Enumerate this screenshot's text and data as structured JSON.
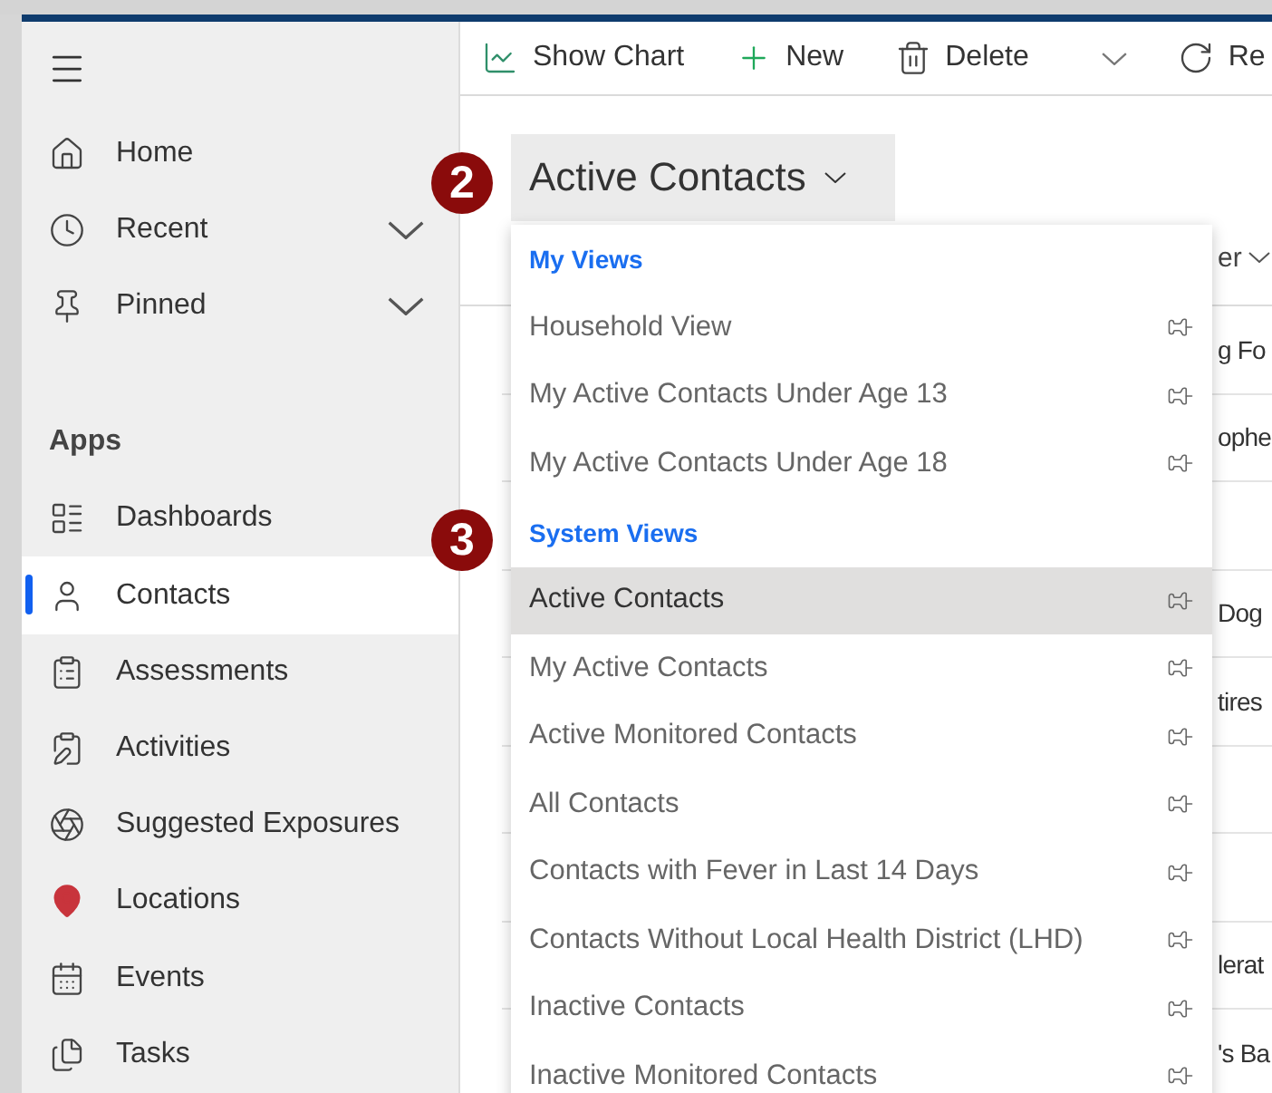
{
  "sidebar": {
    "items": [
      {
        "label": "Home",
        "kind": "link",
        "selected": false
      },
      {
        "label": "Recent",
        "kind": "group",
        "expanded": false,
        "selected": false
      },
      {
        "label": "Pinned",
        "kind": "group",
        "expanded": false,
        "selected": false
      }
    ],
    "section_title": "Apps",
    "apps": [
      {
        "label": "Dashboards",
        "selected": false
      },
      {
        "label": "Contacts",
        "selected": true
      },
      {
        "label": "Assessments",
        "selected": false
      },
      {
        "label": "Activities",
        "selected": false
      },
      {
        "label": "Suggested Exposures",
        "selected": false
      },
      {
        "label": "Locations",
        "selected": false
      },
      {
        "label": "Events",
        "selected": false
      },
      {
        "label": "Tasks",
        "selected": false
      }
    ]
  },
  "command_bar": [
    {
      "kind": "chart",
      "label": "Show Chart"
    },
    {
      "kind": "new",
      "label": "New"
    },
    {
      "kind": "delete",
      "label": "Delete"
    },
    {
      "kind": "split"
    },
    {
      "kind": "refresh",
      "label": "Re"
    }
  ],
  "view_selector": {
    "label": "Active Contacts",
    "expanded": true
  },
  "view_menu": [
    {
      "kind": "header",
      "label": "My Views"
    },
    {
      "kind": "view",
      "label": "Household View",
      "selected": false
    },
    {
      "kind": "view",
      "label": "My Active Contacts Under Age 13",
      "selected": false
    },
    {
      "kind": "view",
      "label": "My Active Contacts Under Age 18",
      "selected": false
    },
    {
      "kind": "header",
      "label": "System Views"
    },
    {
      "kind": "view",
      "label": "Active Contacts",
      "selected": true
    },
    {
      "kind": "view",
      "label": "My Active Contacts",
      "selected": false
    },
    {
      "kind": "view",
      "label": "Active Monitored Contacts",
      "selected": false
    },
    {
      "kind": "view",
      "label": "All Contacts",
      "selected": false
    },
    {
      "kind": "view",
      "label": "Contacts with Fever in Last 14 Days",
      "selected": false
    },
    {
      "kind": "view",
      "label": "Contacts Without Local Health District (LHD)",
      "selected": false
    },
    {
      "kind": "view",
      "label": "Inactive Contacts",
      "selected": false
    },
    {
      "kind": "view",
      "label": "Inactive Monitored Contacts",
      "selected": false
    }
  ],
  "table": {
    "column_header": "er",
    "rows": [
      "g Fo",
      "ophe",
      "",
      "Dog",
      "tires",
      "",
      "",
      "lerat",
      "'s Ba"
    ]
  },
  "callouts": [
    {
      "label": "2"
    },
    {
      "label": "3"
    }
  ]
}
